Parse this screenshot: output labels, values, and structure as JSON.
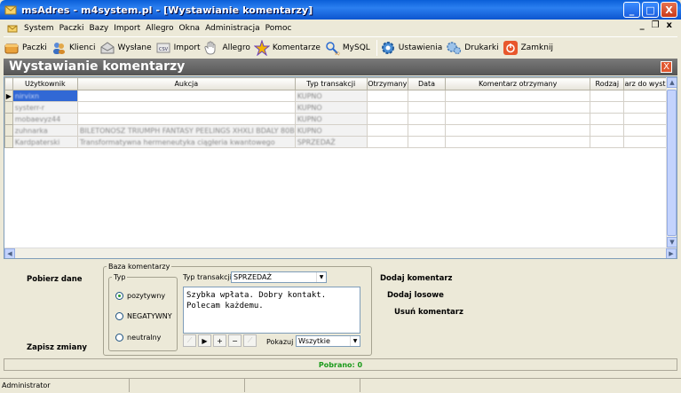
{
  "window": {
    "title": "msAdres - m4system.pl - [Wystawianie komentarzy]",
    "buttons": [
      "_",
      "□",
      "X"
    ]
  },
  "menu": {
    "items": [
      "System",
      "Paczki",
      "Bazy",
      "Import",
      "Allegro",
      "Okna",
      "Administracja",
      "Pomoc"
    ],
    "mdi": [
      "_",
      "Ȧ",
      "x"
    ]
  },
  "toolbar": {
    "paczki": "Paczki",
    "klienci": "Klienci",
    "wyslane": "Wysłane",
    "import": "Import",
    "allegro": "Allegro",
    "komentarze": "Komentarze",
    "mysql": "MySQL",
    "ustawienia": "Ustawienia",
    "drukarki": "Drukarki",
    "zamknij": "Zamknij"
  },
  "panel": {
    "title": "Wystawianie komentarzy",
    "close": "X"
  },
  "grid": {
    "columns": [
      "Użytkownik",
      "Aukcja",
      "Typ transakcji",
      "Otrzymany",
      "Data",
      "Komentarz otrzymany",
      "Rodzaj",
      "arz do wystaw"
    ],
    "rows": [
      [
        "nirvixn",
        "",
        "KUPNO",
        "",
        "",
        "",
        "",
        ""
      ],
      [
        "systerr-r",
        "",
        "KUPNO",
        "",
        "",
        "",
        "",
        ""
      ],
      [
        "mobaevyz44",
        "",
        "KUPNO",
        "",
        "",
        "",
        "",
        ""
      ],
      [
        "zuhnarka",
        "BILETONOSZ TRIUMPH FANTASY PEELINGS XHXLI BDALY 80B",
        "KUPNO",
        "",
        "",
        "",
        "",
        ""
      ],
      [
        "Kardpaterski",
        "Transformatywna hermeneutyka ciągłeria kwantowego",
        "SPRZEDAŻ",
        "",
        "",
        "",
        "",
        ""
      ]
    ],
    "current_row_marker": "▶"
  },
  "bottom": {
    "pobierz": "Pobierz dane",
    "zapisz": "Zapisz zmiany",
    "baza_legend": "Baza komentarzy",
    "typ_legend": "Typ",
    "radio_pos": "pozytywny",
    "radio_neg": "NEGATYWNY",
    "radio_neu": "neutralny",
    "typ_transakcji_label": "Typ transakcji",
    "typ_transakcji_value": "SPRZEDAŻ",
    "comment_text": "Szybka wpłata. Dobry kontakt.\nPolecam każdemu.",
    "pokazuj_label": "Pokazuj",
    "pokazuj_value": "Wszytkie",
    "dodaj": "Dodaj komentarz",
    "dodaj_losowe": "Dodaj losowe",
    "usun": "Usuń komentarz"
  },
  "status": {
    "pobrano": "Pobrano: 0",
    "user": "Administrator"
  }
}
